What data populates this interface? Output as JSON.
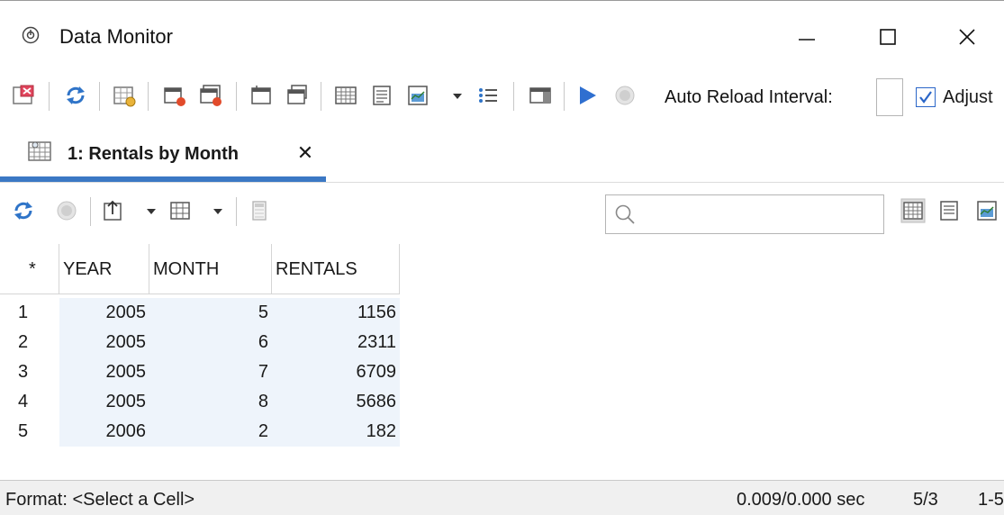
{
  "window": {
    "title": "Data Monitor",
    "minimize_glyph": "—",
    "maximize_glyph": "☐",
    "close_glyph": "✕"
  },
  "toolbar": {
    "auto_reload_label": "Auto Reload Interval:",
    "auto_reload_value": "",
    "adjust_label": "Adjust",
    "adjust_checked": true
  },
  "tab": {
    "label": "1: Rentals by Month",
    "close_glyph": "✕"
  },
  "search": {
    "placeholder": ""
  },
  "grid": {
    "row_marker": "*",
    "columns": [
      "YEAR",
      "MONTH",
      "RENTALS"
    ],
    "rows": [
      {
        "num": "1",
        "year": "2005",
        "month": "5",
        "rentals": "1156"
      },
      {
        "num": "2",
        "year": "2005",
        "month": "6",
        "rentals": "2311"
      },
      {
        "num": "3",
        "year": "2005",
        "month": "7",
        "rentals": "6709"
      },
      {
        "num": "4",
        "year": "2005",
        "month": "8",
        "rentals": "5686"
      },
      {
        "num": "5",
        "year": "2006",
        "month": "2",
        "rentals": "182"
      }
    ]
  },
  "status": {
    "format": "Format: <Select a Cell>",
    "time": "0.009/0.000 sec",
    "rows": "5/3",
    "range": "1-5"
  },
  "colors": {
    "accent_blue": "#3b78c4",
    "cell_bg": "#eef4fb",
    "play_blue": "#2f6fd0",
    "record_red": "#e24b2b"
  }
}
